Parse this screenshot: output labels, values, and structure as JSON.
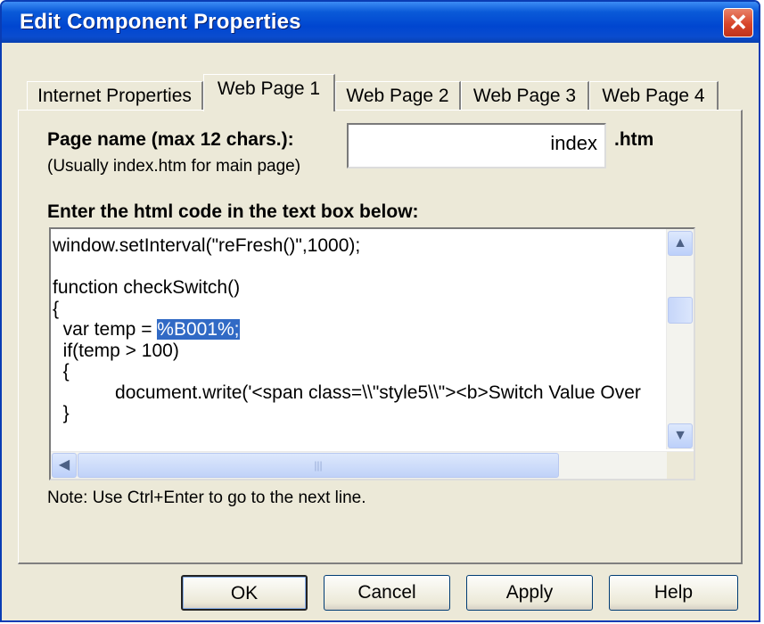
{
  "window": {
    "title": "Edit Component Properties"
  },
  "tabs": [
    {
      "label": "Internet Properties"
    },
    {
      "label": "Web Page 1"
    },
    {
      "label": "Web Page 2"
    },
    {
      "label": "Web Page 3"
    },
    {
      "label": "Web Page 4"
    }
  ],
  "active_tab": "Web Page 1",
  "page_name": {
    "label": "Page name (max 12 chars.):",
    "hint": "(Usually index.htm for main page)",
    "value": "index",
    "suffix": ".htm"
  },
  "code_section": {
    "label": "Enter the html code in the text box below:",
    "lines": [
      "window.setInterval(\"reFresh()\",1000);",
      "",
      "function checkSwitch()",
      "{",
      "  var temp = ",
      "  if(temp > 100)",
      "  {",
      "            document.write('<span class=\\\\\"style5\\\\\"><b>Switch Value Over",
      "  }"
    ],
    "selected_text": "%B001%;",
    "note": "Note: Use Ctrl+Enter to go to the next line."
  },
  "buttons": {
    "ok": "OK",
    "cancel": "Cancel",
    "apply": "Apply",
    "help": "Help"
  },
  "colors": {
    "title_bar": "#0046d0",
    "selection": "#316ac5",
    "dialog_bg": "#ece9d8"
  }
}
